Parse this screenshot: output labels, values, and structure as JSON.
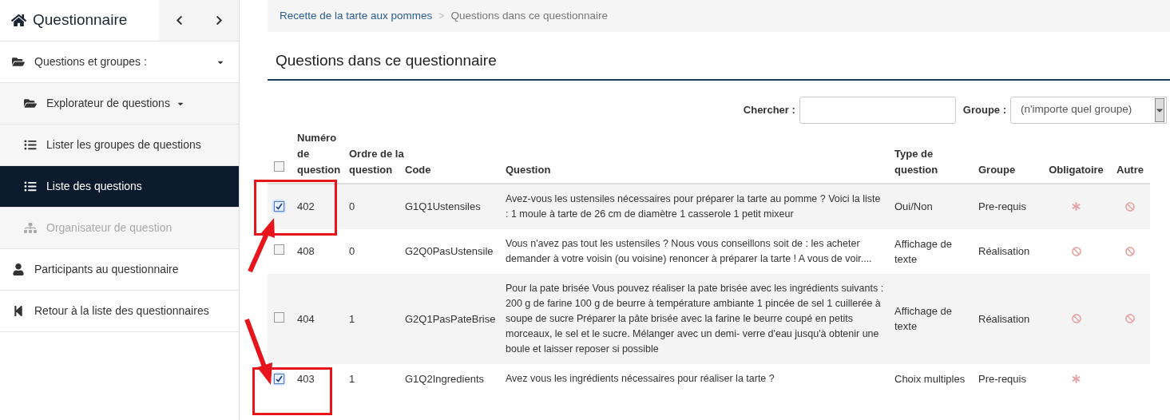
{
  "sidebar": {
    "title": "Questionnaire",
    "items": [
      {
        "kind": "section",
        "label": "Questions et groupes :",
        "caret": true,
        "selected": false,
        "disabled": false
      },
      {
        "kind": "sub",
        "label": "Explorateur de questions",
        "caret": true,
        "selected": false,
        "disabled": false
      },
      {
        "kind": "sub",
        "label": "Lister les groupes de questions",
        "caret": false,
        "selected": false,
        "disabled": false
      },
      {
        "kind": "sub",
        "label": "Liste des questions",
        "caret": false,
        "selected": true,
        "disabled": false
      },
      {
        "kind": "sub",
        "label": "Organisateur de question",
        "caret": false,
        "selected": false,
        "disabled": true
      },
      {
        "kind": "section",
        "label": "Participants au questionnaire",
        "caret": false,
        "selected": false,
        "disabled": false
      },
      {
        "kind": "section",
        "label": "Retour à la liste des questionnaires",
        "caret": false,
        "selected": false,
        "disabled": false
      }
    ]
  },
  "breadcrumb": [
    {
      "label": "Recette de la tarte aux pommes",
      "link": true
    },
    {
      "label": "Questions dans ce questionnaire",
      "link": false
    }
  ],
  "breadcrumb_separator": ">",
  "heading": "Questions dans ce questionnaire",
  "filters": {
    "search_label": "Chercher :",
    "group_label": "Groupe :",
    "group_value": "(n'importe quel groupe)"
  },
  "table": {
    "select_all_checked": false,
    "columns": [
      "Numéro de question",
      "Ordre de la question",
      "Code",
      "Question",
      "Type de question",
      "Groupe",
      "Obligatoire",
      "Autre"
    ],
    "rows": [
      {
        "checked": true,
        "number": "402",
        "order": "0",
        "code": "G1Q1Ustensiles",
        "question": "Avez-vous les ustensiles nécessaires pour préparer la tarte au pomme ? Voici la liste : 1 moule à tarte de 26 cm de diamètre 1 casserole 1 petit mixeur",
        "type": "Oui/Non",
        "group": "Pre-requis",
        "mandatory": true,
        "other": false
      },
      {
        "checked": false,
        "number": "408",
        "order": "0",
        "code": "G2Q0PasUstensile",
        "question": "Vous n'avez pas tout les ustensiles ?   Nous vous conseillons soit de : les acheter demander à votre voisin (ou voisine) renoncer à préparer la tarte ! A vous de voir....",
        "type": "Affichage de texte",
        "group": "Réalisation",
        "mandatory": false,
        "other": false
      },
      {
        "checked": false,
        "number": "404",
        "order": "1",
        "code": "G2Q1PasPateBrise",
        "question": "Pour la pate brisée Vous pouvez réaliser la pate brisée avec les ingrédients suivants :   200 g de farine 100 g de beurre à température ambiante 1 pincée de sel 1 cuillerée à soupe de sucre   Préparer la pâte brisée avec la farine le beurre coupé en petits morceaux, le sel et le sucre. Mélanger avec un demi- verre d'eau jusqu'à obtenir une boule et laisser reposer si possible",
        "type": "Affichage de texte",
        "group": "Réalisation",
        "mandatory": false,
        "other": false
      },
      {
        "checked": true,
        "number": "403",
        "order": "1",
        "code": "G1Q2Ingredients",
        "question": "Avez vous les ingrédients nécessaires pour réaliser la tarte ?",
        "type": "Choix multiples",
        "group": "Pre-requis",
        "mandatory": true
      }
    ]
  }
}
